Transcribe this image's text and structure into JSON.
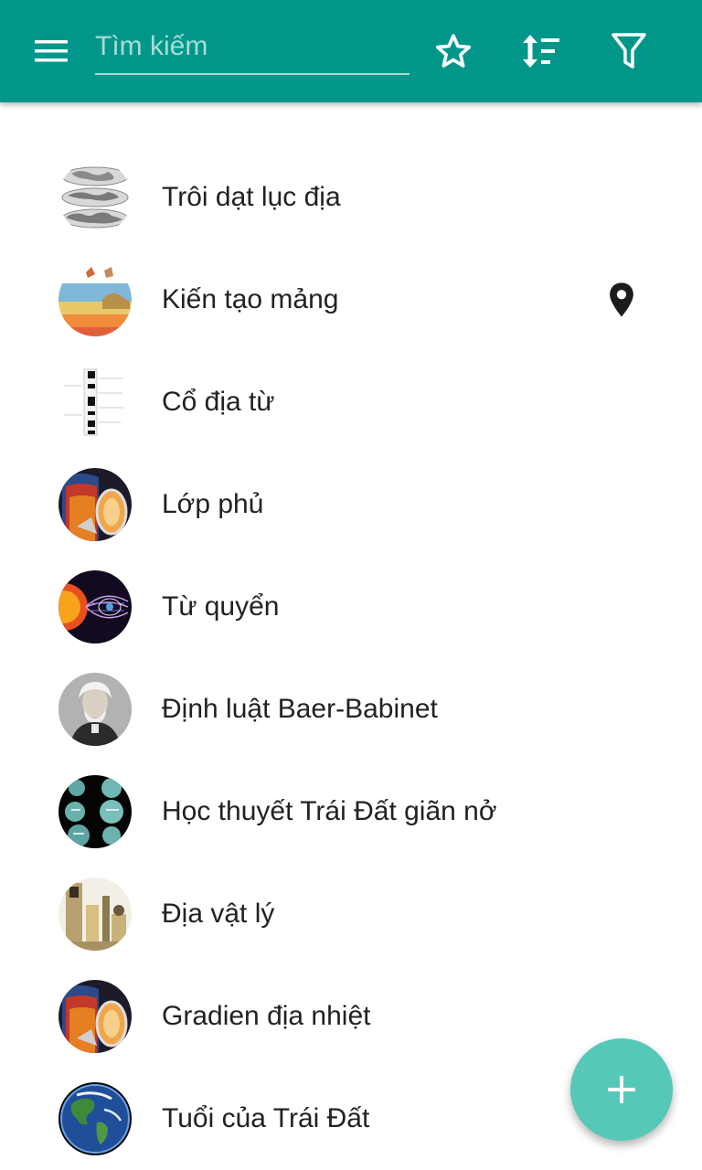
{
  "toolbar": {
    "search": {
      "placeholder": "Tìm kiếm",
      "value": ""
    },
    "icons": [
      "menu-icon",
      "star-icon",
      "sort-icon",
      "filter-icon"
    ],
    "color": "#00978a"
  },
  "items": [
    {
      "label": "Trôi dạt lục địa",
      "thumbnail": "continental-drift-maps"
    },
    {
      "label": "Kiến tạo mảng",
      "thumbnail": "plate-tectonics-diagram",
      "has_location": true
    },
    {
      "label": "Cổ địa từ",
      "thumbnail": "paleomagnetism-stripes"
    },
    {
      "label": "Lớp phủ",
      "thumbnail": "earth-layers-cutaway"
    },
    {
      "label": "Từ quyển",
      "thumbnail": "magnetosphere-sun"
    },
    {
      "label": "Định luật Baer-Babinet",
      "thumbnail": "portrait-photo"
    },
    {
      "label": "Học thuyết Trái Đất giãn nở",
      "thumbnail": "expanding-earth-globes"
    },
    {
      "label": "Địa vật lý",
      "thumbnail": "geophysics-instruments"
    },
    {
      "label": "Gradien địa nhiệt",
      "thumbnail": "earth-layers-cutaway"
    },
    {
      "label": "Tuổi của Trái Đất",
      "thumbnail": "earth-globe"
    }
  ],
  "fab": {
    "icon": "plus-icon",
    "color": "#55c8b8"
  }
}
